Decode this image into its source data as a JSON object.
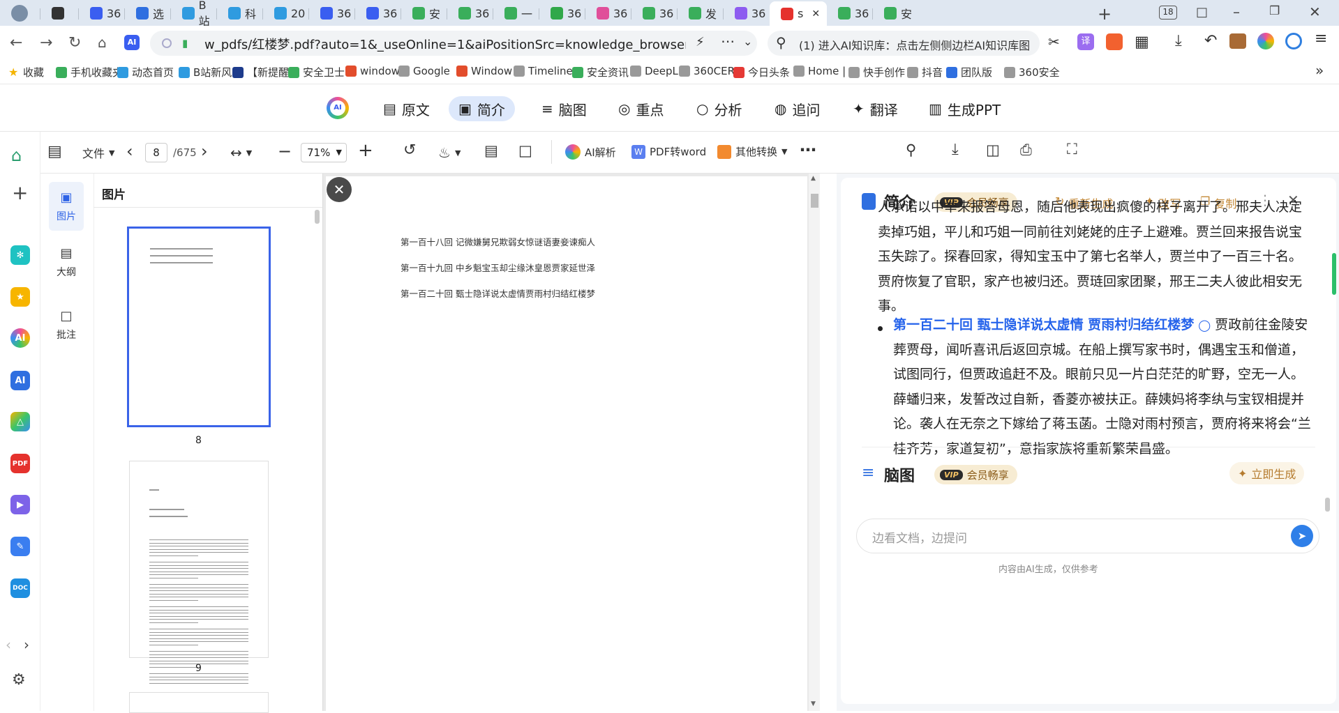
{
  "browser": {
    "tabs": [
      {
        "label": "",
        "icon": "avatar-icon",
        "color": "#7a8ea6"
      },
      {
        "label": "",
        "icon": "send-icon",
        "color": "#333"
      },
      {
        "label": "36",
        "icon": "ai-icon",
        "color": "#3a5ef0"
      },
      {
        "label": "选",
        "icon": "gear-icon",
        "color": "#2f6fe0"
      },
      {
        "label": "B站",
        "icon": "bilibili-icon",
        "color": "#2f9be0"
      },
      {
        "label": "科",
        "icon": "bilibili-icon",
        "color": "#2f9be0"
      },
      {
        "label": "20",
        "icon": "bilibili-icon",
        "color": "#2f9be0"
      },
      {
        "label": "36",
        "icon": "ai-icon",
        "color": "#3a5ef0"
      },
      {
        "label": "36",
        "icon": "ai-icon",
        "color": "#3a5ef0"
      },
      {
        "label": "安",
        "icon": "360-icon",
        "color": "#3aae5b"
      },
      {
        "label": "36",
        "icon": "360-icon",
        "color": "#3aae5b"
      },
      {
        "label": "一",
        "icon": "360-icon",
        "color": "#3aae5b"
      },
      {
        "label": "36",
        "icon": "ie-icon",
        "color": "#31a84a"
      },
      {
        "label": "36",
        "icon": "ai-color-icon",
        "color": "#e04f9a"
      },
      {
        "label": "36",
        "icon": "360-icon",
        "color": "#3aae5b"
      },
      {
        "label": "发",
        "icon": "360-icon",
        "color": "#3aae5b"
      },
      {
        "label": "36",
        "icon": "ai-color-icon",
        "color": "#8d5cf0"
      },
      {
        "label": "s",
        "icon": "pdf-icon",
        "color": "#e5322d",
        "active": true
      },
      {
        "label": "36",
        "icon": "360-icon",
        "color": "#3aae5b"
      },
      {
        "label": "安",
        "icon": "360-icon",
        "color": "#3aae5b"
      }
    ],
    "tab_count": "18",
    "url": "w_pdfs/红楼梦.pdf?auto=1&_useOnline=1&aiPositionSrc=knowledge_browserSE",
    "search_text": "(1) 进入AI知识库：点击左侧侧边栏AI知识库图",
    "bookmarks": [
      {
        "label": "收藏",
        "color": "#f4b400"
      },
      {
        "label": "手机收藏夹",
        "color": "#3aae5b"
      },
      {
        "label": "动态首页",
        "color": "#2f9be0"
      },
      {
        "label": "B站新风",
        "color": "#2f9be0"
      },
      {
        "label": "【新提醒",
        "color": "#1d3b8c"
      },
      {
        "label": "安全卫士",
        "color": "#3aae5b"
      },
      {
        "label": "window",
        "color": "#e24d2c"
      },
      {
        "label": "Google",
        "color": "#999"
      },
      {
        "label": "Window",
        "color": "#e24d2c"
      },
      {
        "label": "Timeline",
        "color": "#999"
      },
      {
        "label": "安全资讯",
        "color": "#3aae5b"
      },
      {
        "label": "DeepL",
        "color": "#999"
      },
      {
        "label": "360CER",
        "color": "#999"
      },
      {
        "label": "今日头条",
        "color": "#e53935"
      },
      {
        "label": "Home |",
        "color": "#999"
      },
      {
        "label": "快手创作",
        "color": "#999"
      },
      {
        "label": "抖音",
        "color": "#999"
      },
      {
        "label": "团队版",
        "color": "#2f6fe0"
      },
      {
        "label": "360安全",
        "color": "#999"
      }
    ]
  },
  "ai_nav": {
    "items": [
      "原文",
      "简介",
      "脑图",
      "重点",
      "分析",
      "追问",
      "翻译",
      "生成PPT"
    ],
    "active": "简介"
  },
  "toolbar": {
    "file_label": "文件",
    "page_current": "8",
    "page_total": "/675",
    "zoom": "71%",
    "ai_parse_label": "AI解析",
    "pdf_to_word_label": "PDF转word",
    "other_convert_label": "其他转换"
  },
  "thumb_panel": {
    "tabs": [
      "图片",
      "大纲",
      "批注"
    ],
    "header": "图片",
    "pages": [
      "8",
      "9"
    ]
  },
  "document": {
    "lines": [
      "第一百十八回  记微嫌舅兄欺弱女惊谜语妻妾谏痴人",
      "第一百十九回  中乡魁宝玉却尘缘沐皇恩贾家延世泽",
      "第一百二十回  甄士隐详说太虚情贾雨村归结红楼梦"
    ]
  },
  "ai_panel": {
    "summary_title": "简介",
    "vip_tag": "VIP",
    "vip_label": "会员畅享",
    "regenerate": "重新生成",
    "rewrite": "改写",
    "copy": "复制",
    "para1": "人承诺以中举来报答母恩，随后他表现出疯傻的样子离开了。邢夫人决定卖掉巧姐，平儿和巧姐一同前往刘姥姥的庄子上避难。贾兰回来报告说宝玉失踪了。探春回家，得知宝玉中了第七名举人，贾兰中了一百三十名。贾府恢复了官职，家产也被归还。贾琏回家团聚，邢王二夫人彼此相安无事。",
    "bullet_title": "第一百二十回 甄士隐详说太虚情 贾雨村归结红楼梦",
    "bullet_body": "贾政前往金陵安葬贾母，闻听喜讯后返回京城。在船上撰写家书时，偶遇宝玉和僧道，试图同行，但贾政追赶不及。眼前只见一片白茫茫的旷野，空无一人。薛蟠归来，发誓改过自新，香菱亦被扶正。薛姨妈将李纨与宝钗相提并论。袭人在无奈之下嫁给了蒋玉菡。士隐对雨村预言，贾府将来将会“兰桂齐芳，家道复初”，意指家族将重新繁荣昌盛。",
    "mindmap_title": "脑图",
    "generate_now": "立即生成",
    "input_placeholder": "边看文档，边提问",
    "disclaimer": "内容由AI生成，仅供参考"
  }
}
